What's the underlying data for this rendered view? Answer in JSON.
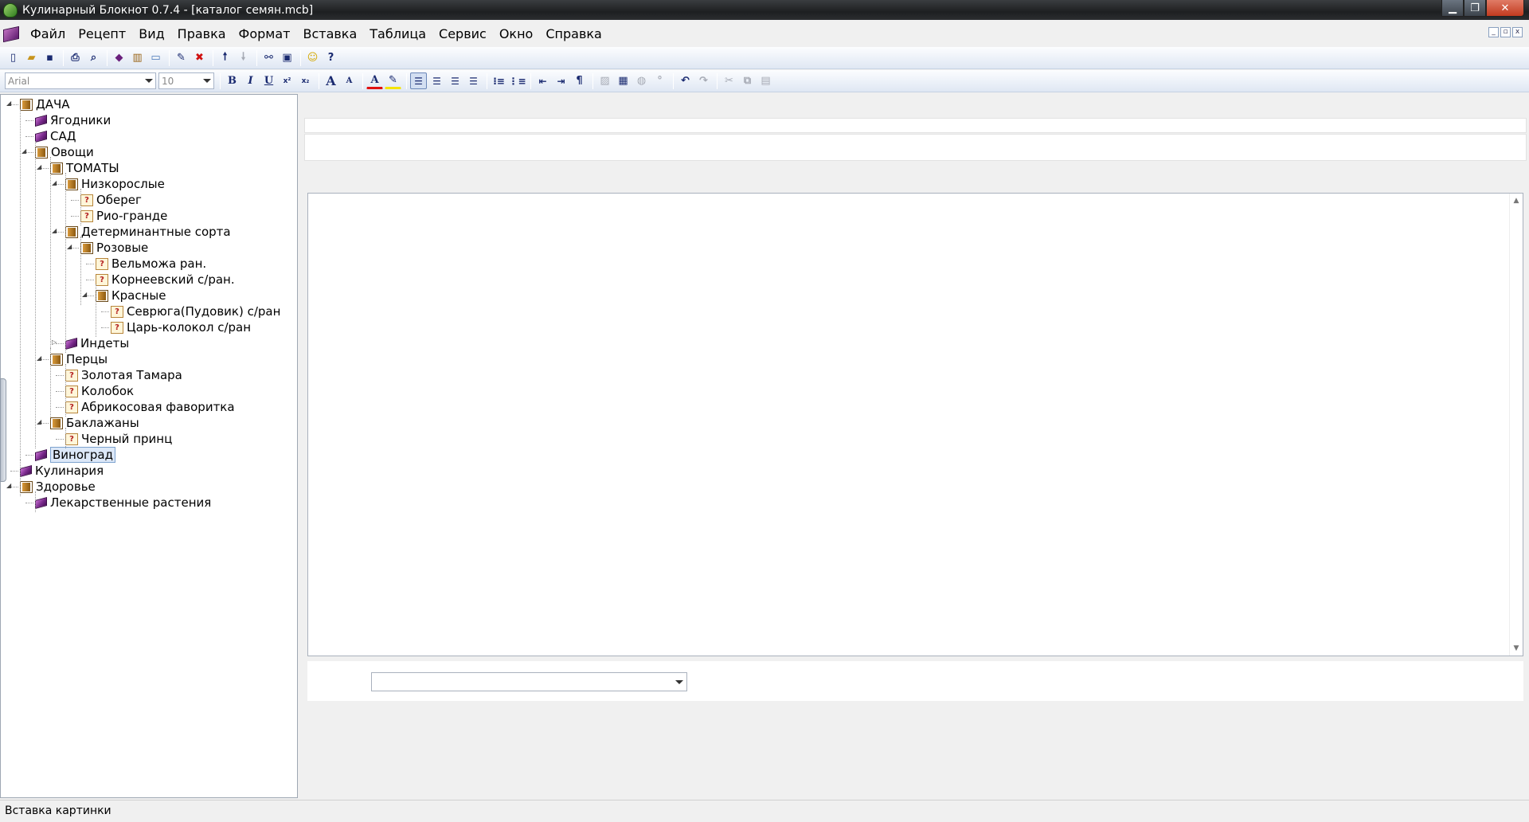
{
  "window": {
    "title": "Кулинарный Блокнот 0.7.4 - [каталог семян.mcb]"
  },
  "menu": [
    "Файл",
    "Рецепт",
    "Вид",
    "Правка",
    "Формат",
    "Вставка",
    "Таблица",
    "Сервис",
    "Окно",
    "Справка"
  ],
  "toolbar": {
    "font_name": "Arial",
    "font_size": "10",
    "bold": "B",
    "italic": "I",
    "underline": "U",
    "superscript": "x²",
    "subscript": "x₂",
    "grow_font": "A",
    "shrink_font": "A",
    "font_color": "A",
    "pilcrow": "¶",
    "help": "?"
  },
  "tree": [
    {
      "label": "ДАЧА",
      "icon": "catalog-icon",
      "expanded": true
    },
    {
      "label": "Ягодники",
      "icon": "book-icon"
    },
    {
      "label": "САД",
      "icon": "book-icon"
    },
    {
      "label": "Овощи",
      "icon": "catalog-icon",
      "expanded": true
    },
    {
      "label": "ТОМАТЫ",
      "icon": "catalog-icon",
      "expanded": true
    },
    {
      "label": "Низкорослые",
      "icon": "catalog-icon",
      "expanded": true
    },
    {
      "label": "Оберег",
      "icon": "recipe-icon"
    },
    {
      "label": "Рио-гранде",
      "icon": "recipe-icon"
    },
    {
      "label": "Детерминантные  сорта",
      "icon": "catalog-icon",
      "expanded": true
    },
    {
      "label": "Розовые",
      "icon": "catalog-icon",
      "expanded": true
    },
    {
      "label": "Вельможа ран.",
      "icon": "recipe-icon"
    },
    {
      "label": "Корнеевский с/ран.",
      "icon": "recipe-icon"
    },
    {
      "label": "Красные",
      "icon": "catalog-icon",
      "expanded": true
    },
    {
      "label": "Севрюга(Пудовик) с/ран",
      "icon": "recipe-icon"
    },
    {
      "label": "Царь-колокол с/ран",
      "icon": "recipe-icon"
    },
    {
      "label": "Индеты",
      "icon": "book-icon",
      "expanded": false
    },
    {
      "label": "Перцы",
      "icon": "catalog-icon",
      "expanded": true
    },
    {
      "label": "Золотая Тамара",
      "icon": "recipe-icon"
    },
    {
      "label": "Колобок",
      "icon": "recipe-icon"
    },
    {
      "label": "Абрикосовая фаворитка",
      "icon": "recipe-icon"
    },
    {
      "label": "Баклажаны",
      "icon": "catalog-icon",
      "expanded": true
    },
    {
      "label": "Черный принц",
      "icon": "recipe-icon"
    },
    {
      "label": "Виноград",
      "icon": "book-icon",
      "selected": true
    },
    {
      "label": "Кулинария",
      "icon": "book-icon"
    },
    {
      "label": "Здоровье",
      "icon": "catalog-icon",
      "expanded": true
    },
    {
      "label": "Лекарственные растения",
      "icon": "book-icon"
    }
  ],
  "status": {
    "text": "Вставка картинки"
  },
  "colors": {
    "accent": "#dce8f8",
    "toolbar_bg": "#dfe7f3",
    "font_color_red": "#e01010",
    "highlight_yellow": "#f5e400"
  }
}
